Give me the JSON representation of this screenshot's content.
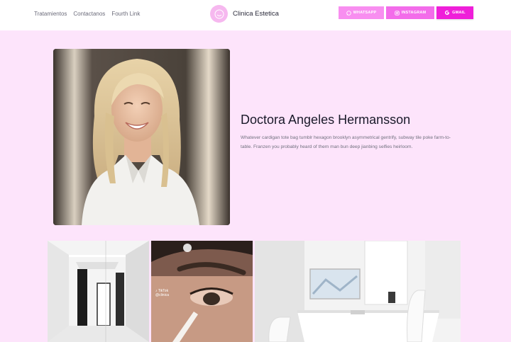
{
  "nav": {
    "links": [
      "Tratamientos",
      "Contactanos",
      "Fourth Link"
    ],
    "brand": "Clinica Estetica"
  },
  "social": {
    "whatsapp": "WHATSAPP",
    "instagram": "INSTAGRAM",
    "gmail": "GMAIL"
  },
  "hero": {
    "title": "Doctora Angeles Hermansson",
    "description": "Whatever cardigan tote bag tumblr hexagon brooklyn asymmetrical gentrify, subway tile poke farm-to-table. Franzen you probably heard of them man bun deep jianbing selfies heirloom."
  },
  "gallery": {
    "tiktok_label": "TikTok",
    "tiktok_handle": "@clinica"
  },
  "colors": {
    "page_bg": "#fde4fb",
    "whatsapp": "#f88ef0",
    "instagram": "#f36cea",
    "gmail": "#ef1ed9"
  },
  "icons": [
    "smile-logo-icon",
    "whatsapp-icon",
    "instagram-icon",
    "google-icon",
    "tiktok-icon"
  ]
}
